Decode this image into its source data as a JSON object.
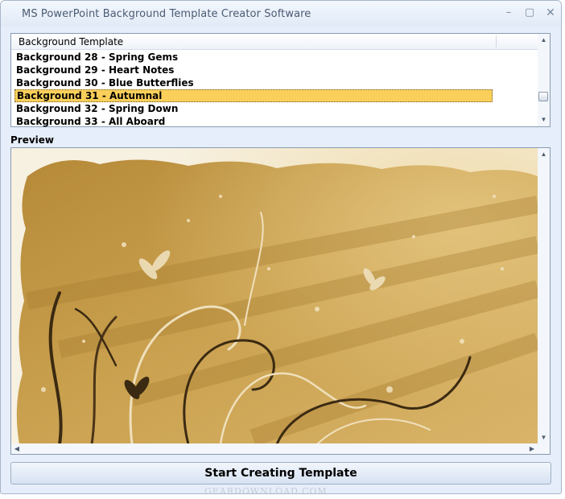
{
  "window": {
    "title": "MS PowerPoint Background Template Creator Software"
  },
  "titlebar_buttons": {
    "minimize": "–",
    "maximize": "▢",
    "close": "✕"
  },
  "template_list": {
    "header": "Background Template",
    "items": [
      {
        "label": "Background 28 - Spring Gems",
        "selected": false
      },
      {
        "label": "Background 29 - Heart Notes",
        "selected": false
      },
      {
        "label": "Background 30 - Blue Butterflies",
        "selected": false
      },
      {
        "label": "Background 31 - Autumnal",
        "selected": true
      },
      {
        "label": "Background 32 - Spring Down",
        "selected": false
      },
      {
        "label": "Background 33 - All Aboard",
        "selected": false
      }
    ]
  },
  "preview": {
    "label": "Preview"
  },
  "actions": {
    "start_label": "Start Creating Template"
  },
  "watermark": "GEARDOWNLOAD.COM",
  "colors": {
    "selection": "#fbd05a",
    "window_bg": "#e5eefa",
    "preview_gold": "#c9a04e"
  }
}
